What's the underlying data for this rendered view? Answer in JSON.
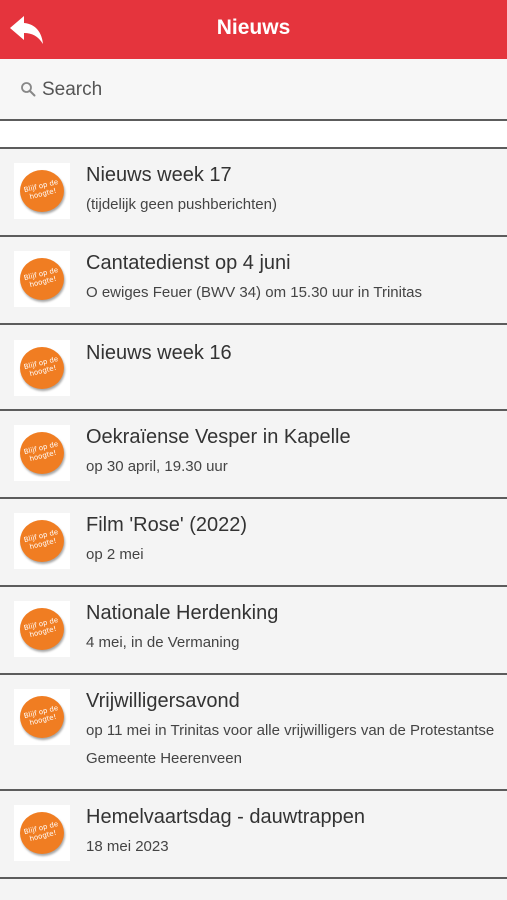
{
  "navbar": {
    "title": "Nieuws",
    "back_icon": "back-arrow-icon",
    "background": "#e5343d"
  },
  "search": {
    "placeholder": "Search",
    "icon": "search-icon"
  },
  "news_items": [
    {
      "title": "Nieuws week 17",
      "subtitle": "(tijdelijk geen pushberichten)"
    },
    {
      "title": "Cantatedienst op 4 juni",
      "subtitle": "O ewiges Feuer (BWV 34) om 15.30 uur in Trinitas"
    },
    {
      "title": "Nieuws week 16",
      "subtitle": ""
    },
    {
      "title": "Oekraïense Vesper in Kapelle",
      "subtitle": "op 30 april, 19.30 uur"
    },
    {
      "title": "Film 'Rose' (2022)",
      "subtitle": "op 2 mei"
    },
    {
      "title": "Nationale Herdenking",
      "subtitle": "4 mei, in de Vermaning"
    },
    {
      "title": "Vrijwilligersavond",
      "subtitle": "op 11 mei in Trinitas voor alle vrijwilligers van de Protestantse Gemeente Heerenveen"
    },
    {
      "title": "Hemelvaartsdag - dauwtrappen",
      "subtitle": "18 mei 2023"
    }
  ],
  "thumbnail": {
    "text": "Blijf op de hoogte!",
    "icon": "blijf-op-de-hoogte-badge-icon",
    "color": "#f07d22"
  }
}
